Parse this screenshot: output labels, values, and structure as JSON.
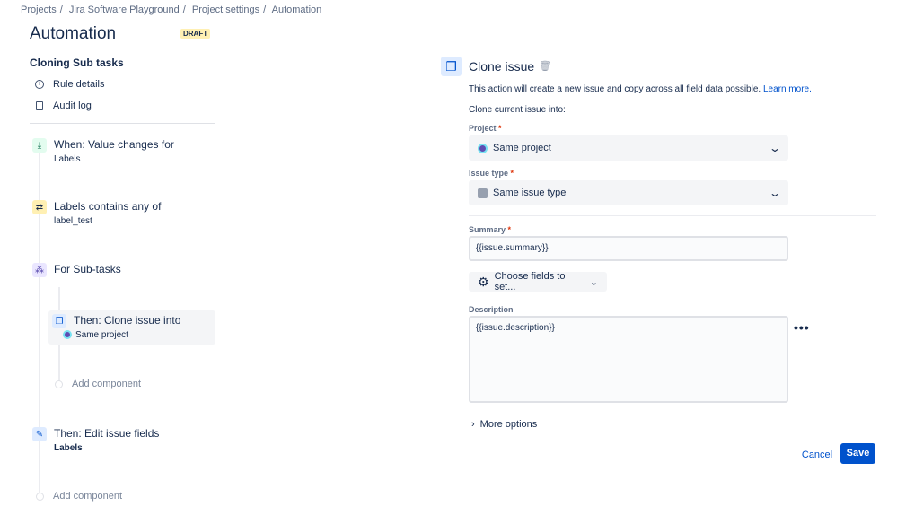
{
  "breadcrumb": [
    "Projects",
    "Jira Software Playground",
    "Project settings",
    "Automation"
  ],
  "page_title": "Automation",
  "draft_badge": "DRAFT",
  "rule_name": "Cloning Sub tasks",
  "nav": [
    {
      "label": "Rule details",
      "icon": "info-icon"
    },
    {
      "label": "Audit log",
      "icon": "document-icon"
    }
  ],
  "steps": {
    "trigger": {
      "title": "When: Value changes for",
      "sub": "Labels"
    },
    "condition": {
      "title": "Labels contains any of",
      "sub": "label_test"
    },
    "branch": {
      "title": "For Sub-tasks"
    },
    "clone": {
      "title": "Then: Clone issue into",
      "sub": "Same project"
    },
    "add_inner": "Add component",
    "edit": {
      "title": "Then: Edit issue fields",
      "sub": "Labels"
    },
    "add_outer": "Add component"
  },
  "panel": {
    "title": "Clone issue",
    "description": "This action will create a new issue and copy across all field data possible.",
    "learn_more": "Learn more.",
    "clone_into": "Clone current issue into:",
    "project_label": "Project",
    "project_value": "Same project",
    "issue_type_label": "Issue type",
    "issue_type_value": "Same issue type",
    "summary_label": "Summary",
    "summary_value": "{{issue.summary}}",
    "choose_fields": "Choose fields to set...",
    "description_label": "Description",
    "description_value": "{{issue.description}}",
    "more_options": "More options",
    "cancel": "Cancel",
    "save": "Save",
    "required": "*"
  }
}
